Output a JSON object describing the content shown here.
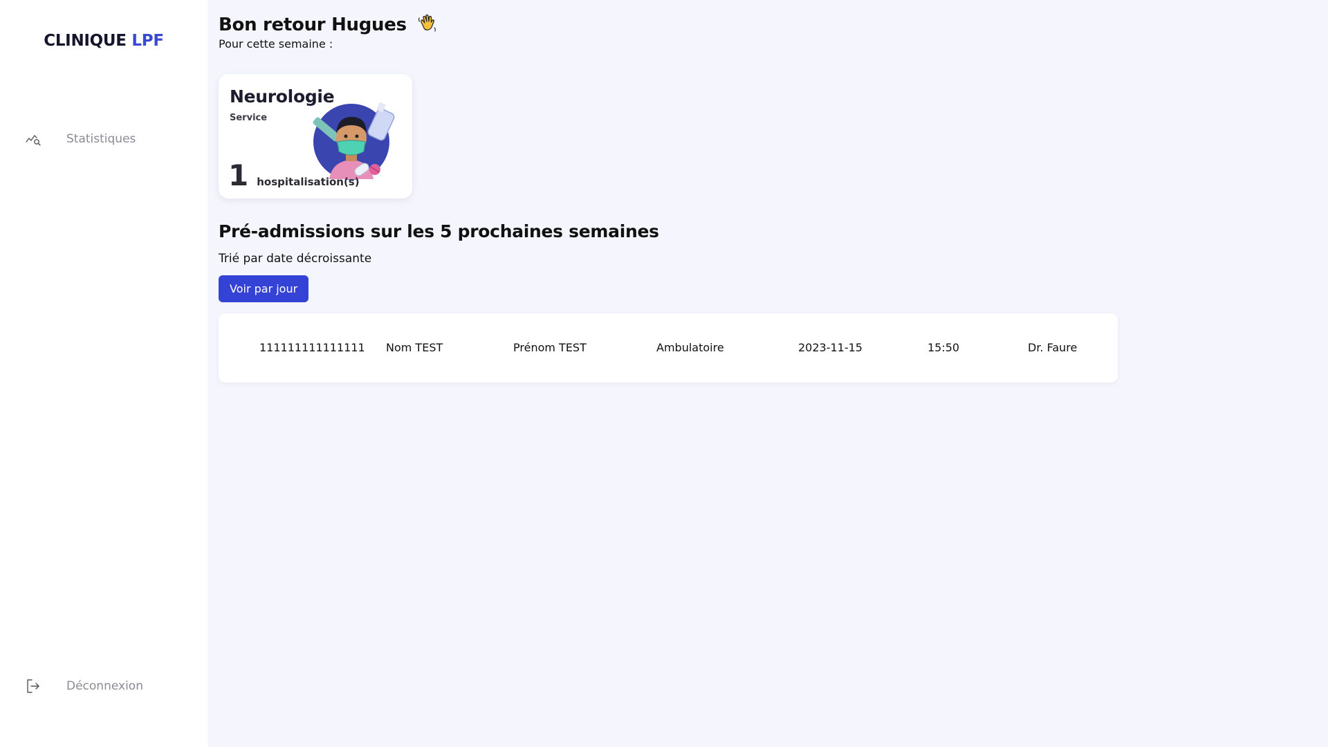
{
  "app": {
    "logo_main": "CLINIQUE",
    "logo_accent": "LPF",
    "accent_color": "#3949d4"
  },
  "sidebar": {
    "items": [
      {
        "label": "Statistiques",
        "icon": "stats-search-icon"
      }
    ],
    "logout": {
      "label": "Déconnexion",
      "icon": "logout-icon"
    }
  },
  "header": {
    "greeting": "Bon retour Hugues",
    "greeting_icon": "waving-hand-icon",
    "subtitle": "Pour cette semaine :"
  },
  "service_card": {
    "name": "Neurologie",
    "label": "Service",
    "count": "1",
    "count_label": "hospitalisation(s)",
    "illustration": "masked-doctor-illustration"
  },
  "preadmissions": {
    "title": "Pré-admissions sur les 5 prochaines semaines",
    "sort_note": "Trié par date décroissante",
    "button_label": "Voir par jour",
    "rows": [
      {
        "id": "111111111111111",
        "nom": "Nom TEST",
        "prenom": "Prénom TEST",
        "type": "Ambulatoire",
        "date": "2023-11-15",
        "heure": "15:50",
        "medecin": "Dr. Faure"
      }
    ]
  }
}
